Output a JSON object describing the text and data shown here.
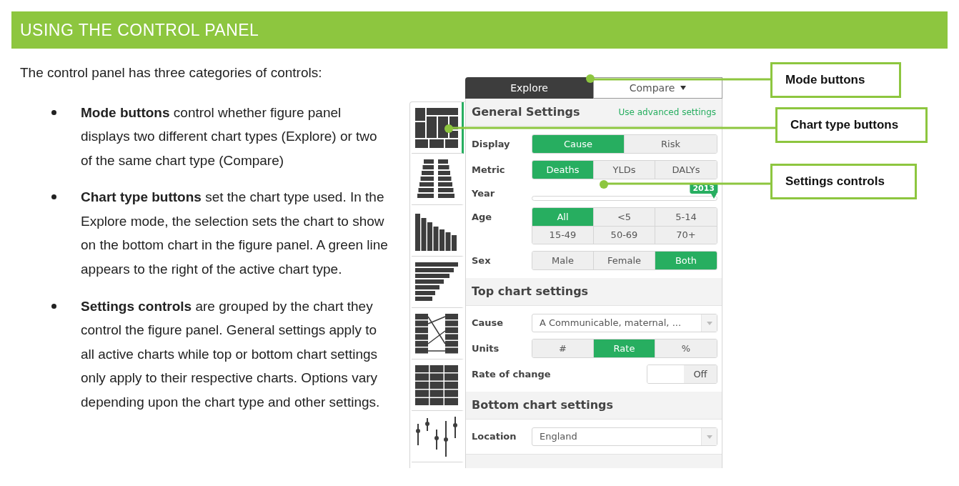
{
  "header": {
    "title": "USING THE CONTROL PANEL"
  },
  "intro": "The control panel has three categories of controls:",
  "bullets": [
    "**Mode buttons** control whether figure panel displays two different chart types (Explore) or two of the same chart type (Compare)",
    "**Chart type buttons** set the chart type used. In the Explore mode, the selection sets the chart to show on the bottom chart in the figure panel. A green line appears to the right of the active chart type.",
    "**Settings controls** are grouped by the chart they control the figure panel. General settings apply to all active charts while top or bottom chart settings only apply to their respective charts. Options vary depending upon the chart type and other settings."
  ],
  "panel": {
    "mode_tabs": [
      {
        "label": "Explore",
        "selected": true,
        "dropdown": false
      },
      {
        "label": "Compare",
        "selected": false,
        "dropdown": true
      }
    ],
    "chart_types": [
      {
        "kind": "treemap",
        "selected": true
      },
      {
        "kind": "pyramid",
        "selected": false
      },
      {
        "kind": "bars",
        "selected": false
      },
      {
        "kind": "stairs",
        "selected": false
      },
      {
        "kind": "arrows",
        "selected": false
      },
      {
        "kind": "grid",
        "selected": false
      },
      {
        "kind": "ranges",
        "selected": false
      }
    ],
    "sections": [
      {
        "title": "General Settings",
        "link": "Use advanced settings",
        "rows": [
          {
            "kind": "segmented",
            "label": "Display",
            "options": [
              {
                "label": "Cause",
                "selected": true
              },
              {
                "label": "Risk",
                "selected": false
              }
            ]
          },
          {
            "kind": "segmented",
            "label": "Metric",
            "options": [
              {
                "label": "Deaths",
                "selected": true
              },
              {
                "label": "YLDs",
                "selected": false
              },
              {
                "label": "DALYs",
                "selected": false
              }
            ]
          },
          {
            "kind": "slider",
            "label": "Year",
            "reading": "2013",
            "level": 1
          },
          {
            "kind": "segmented",
            "label": "Age",
            "options": [
              {
                "label": "All",
                "selected": true
              },
              {
                "label": "<5",
                "selected": false
              },
              {
                "label": "5-14",
                "selected": false
              },
              {
                "label": "15-49",
                "selected": false
              },
              {
                "label": "50-69",
                "selected": false
              },
              {
                "label": "70+",
                "selected": false
              }
            ]
          },
          {
            "kind": "segmented",
            "label": "Sex",
            "options": [
              {
                "label": "Male",
                "selected": false
              },
              {
                "label": "Female",
                "selected": false
              },
              {
                "label": "Both",
                "selected": true
              }
            ]
          }
        ]
      },
      {
        "title": "Top chart settings",
        "rows": [
          {
            "kind": "select",
            "label": "Cause",
            "value": "A Communicable, maternal, ..."
          },
          {
            "kind": "segmented",
            "label": "Units",
            "options": [
              {
                "label": "#",
                "selected": false
              },
              {
                "label": "Rate",
                "selected": true
              },
              {
                "label": "%",
                "selected": false
              }
            ]
          },
          {
            "kind": "toggle",
            "label": "Rate of change",
            "on": false,
            "state_text": "Off"
          }
        ]
      },
      {
        "title": "Bottom chart settings",
        "rows": [
          {
            "kind": "select",
            "label": "Location",
            "value": "England"
          }
        ]
      }
    ]
  },
  "callouts": [
    {
      "label": "Mode buttons"
    },
    {
      "label": "Chart type buttons"
    },
    {
      "label": "Settings controls"
    }
  ]
}
